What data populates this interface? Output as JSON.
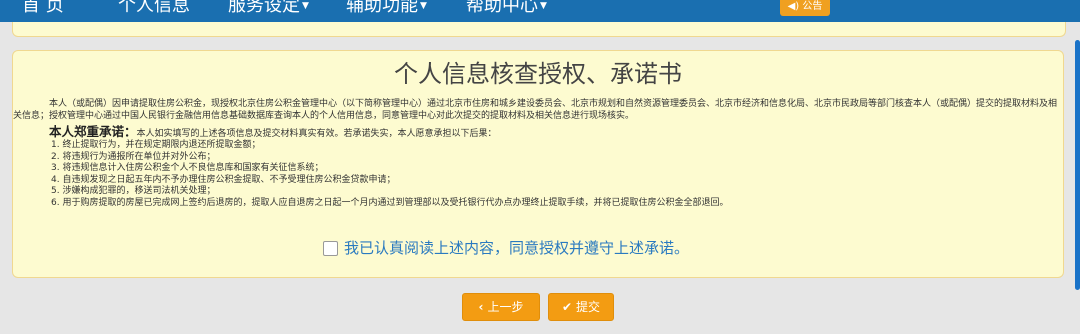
{
  "nav": {
    "items": [
      {
        "label": "首  页",
        "dropdown": false
      },
      {
        "label": "个人信息",
        "dropdown": false
      },
      {
        "label": "服务设定",
        "dropdown": true
      },
      {
        "label": "辅助功能",
        "dropdown": true
      },
      {
        "label": "帮助中心",
        "dropdown": true
      }
    ],
    "notice_label": "公告"
  },
  "panel": {
    "title": "个人信息核查授权、承诺书",
    "intro": "本人（或配偶）因申请提取住房公积金，现授权北京住房公积金管理中心（以下简称管理中心）通过北京市住房和城乡建设委员会、北京市规划和自然资源管理委员会、北京市经济和信息化局、北京市民政局等部门核查本人（或配偶）提交的提取材料及相关信息；授权管理中心通过中国人民银行金融信用信息基础数据库查询本人的个人信用信息，同意管理中心对此次提交的提取材料及相关信息进行现场核实。",
    "promise_title": "本人郑重承诺：",
    "promise_text": "本人如实填写的上述各项信息及提交材料真实有效。若承诺失实，本人愿意承担以下后果：",
    "rules": [
      "1. 终止提取行为，并在规定期限内退还所提取金额；",
      "2. 将违规行为通报所在单位并对外公布；",
      "3. 将违规信息计入住房公积金个人不良信息库和国家有关征信系统；",
      "4. 自违规发现之日起五年内不予办理住房公积金提取、不予受理住房公积金贷款申请；",
      "5. 涉嫌构成犯罪的，移送司法机关处理；",
      "6. 用于购房提取的房屋已完成网上签约后退房的，提取人应自退房之日起一个月内通过到管理部以及受托银行代办点办理终止提取手续，并将已提取住房公积金全部退回。"
    ],
    "agree_label": "我已认真阅读上述内容，同意授权并遵守上述承诺。",
    "agree_checked": false
  },
  "buttons": {
    "prev_label": "上一步",
    "submit_label": "提交"
  },
  "colors": {
    "navbar": "#1a6fb0",
    "panel_bg": "#fdfbd0",
    "button": "#f39c12",
    "agree_text": "#2a7ac0"
  }
}
